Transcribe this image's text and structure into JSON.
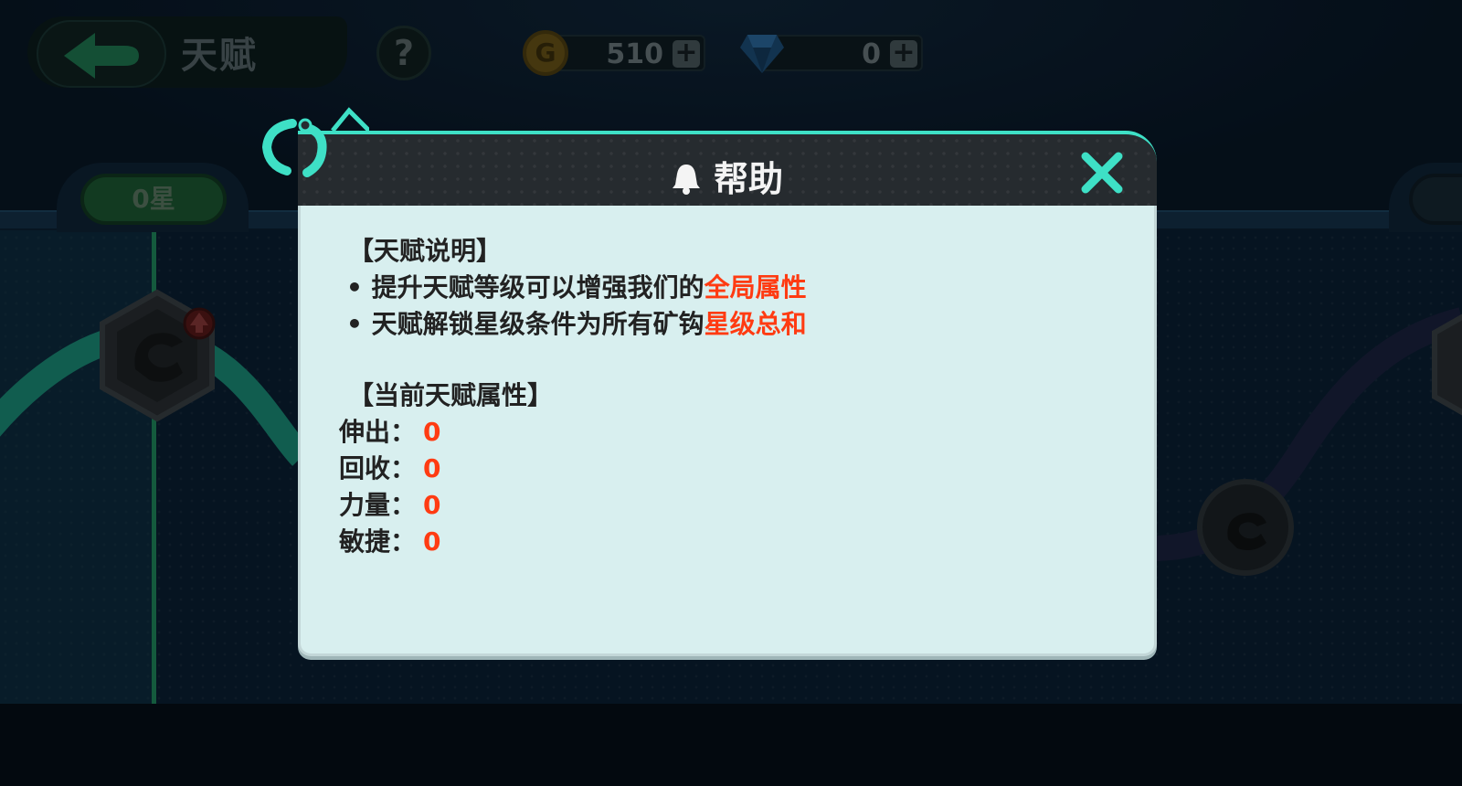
{
  "hud": {
    "title": "天赋",
    "help_glyph": "?",
    "gold": {
      "value": "510",
      "icon": "gold-coin-icon",
      "coin_glyph": "G"
    },
    "gems": {
      "value": "0",
      "icon": "diamond-icon"
    },
    "plus_glyph": "+"
  },
  "stars_tab": {
    "label": "0星"
  },
  "modal": {
    "title": "帮助",
    "title_icon": "bell-icon",
    "close_icon": "close-x-icon",
    "sections": {
      "info_title": "【天赋说明】",
      "bullets": [
        {
          "prefix": "• 提升天赋等级可以增强我们的",
          "highlight": "全局属性"
        },
        {
          "prefix": "• 天赋解锁星级条件为所有矿钩",
          "highlight": "星级总和"
        }
      ],
      "attrs_title": "【当前天赋属性】",
      "stats": [
        {
          "label": "伸出：",
          "value": "0"
        },
        {
          "label": "回收：",
          "value": "0"
        },
        {
          "label": "力量：",
          "value": "0"
        },
        {
          "label": "敏捷：",
          "value": "0"
        }
      ]
    }
  },
  "colors": {
    "accent": "#3ee0c6",
    "highlight": "#ff3b12",
    "panel": "#d8efef",
    "header": "#262b2f"
  }
}
